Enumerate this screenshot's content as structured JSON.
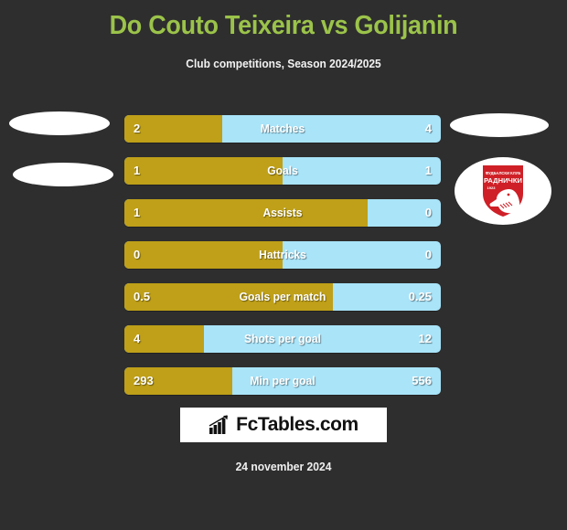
{
  "header": {
    "title": "Do Couto Teixeira vs Golijanin",
    "subtitle": "Club competitions, Season 2024/2025"
  },
  "colors": {
    "background": "#2e2e2e",
    "title": "#9bc34a",
    "home_bar": "#bfa018",
    "away_bar": "#a9e4f9",
    "text": "#ffffff",
    "crest_red": "#cf2027"
  },
  "crest": {
    "name": "fk-radnicki-crest",
    "top_text": "ФУДБАЛСКИ КЛУБ",
    "main_text": "РАДНИЧКИ",
    "year": "1923"
  },
  "chart_data": {
    "type": "bar",
    "title": "Do Couto Teixeira vs Golijanin",
    "subtitle": "Club competitions, Season 2024/2025",
    "orientation": "horizontal-diverging",
    "series": [
      {
        "name": "Do Couto Teixeira",
        "side": "home",
        "color": "#bfa018"
      },
      {
        "name": "Golijanin",
        "side": "away",
        "color": "#a9e4f9"
      }
    ],
    "categories": [
      "Matches",
      "Goals",
      "Assists",
      "Hattricks",
      "Goals per match",
      "Shots per goal",
      "Min per goal"
    ],
    "rows": [
      {
        "label": "Matches",
        "home": "2",
        "away": "4",
        "home_pct": 31
      },
      {
        "label": "Goals",
        "home": "1",
        "away": "1",
        "home_pct": 50
      },
      {
        "label": "Assists",
        "home": "1",
        "away": "0",
        "home_pct": 77
      },
      {
        "label": "Hattricks",
        "home": "0",
        "away": "0",
        "home_pct": 50
      },
      {
        "label": "Goals per match",
        "home": "0.5",
        "away": "0.25",
        "home_pct": 66
      },
      {
        "label": "Shots per goal",
        "home": "4",
        "away": "12",
        "home_pct": 25
      },
      {
        "label": "Min per goal",
        "home": "293",
        "away": "556",
        "home_pct": 34
      }
    ]
  },
  "footer": {
    "brand_text": "FcTables.com",
    "brand_icon": "bar-chart-icon",
    "date": "24 november 2024"
  }
}
